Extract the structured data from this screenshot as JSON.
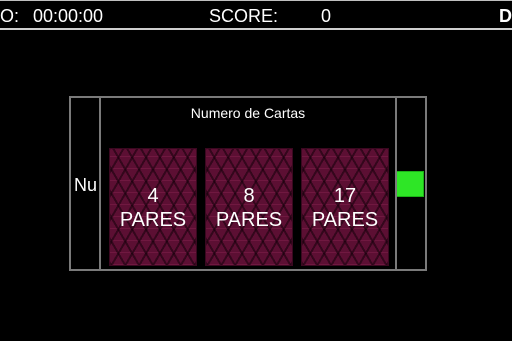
{
  "hud": {
    "time_label": "O:",
    "time_value": "00:00:00",
    "score_label": "SCORE:",
    "score_value": "0",
    "right_label": "D"
  },
  "background": {
    "partial_text": "Nu"
  },
  "dialog": {
    "title": "Numero de Cartas",
    "options": [
      {
        "count": "4",
        "label": "PARES"
      },
      {
        "count": "8",
        "label": "PARES"
      },
      {
        "count": "17",
        "label": "PARES"
      }
    ]
  },
  "colors": {
    "card": "#5c0f33",
    "button": "#2ee626",
    "panel_border": "#7a7a7a"
  }
}
